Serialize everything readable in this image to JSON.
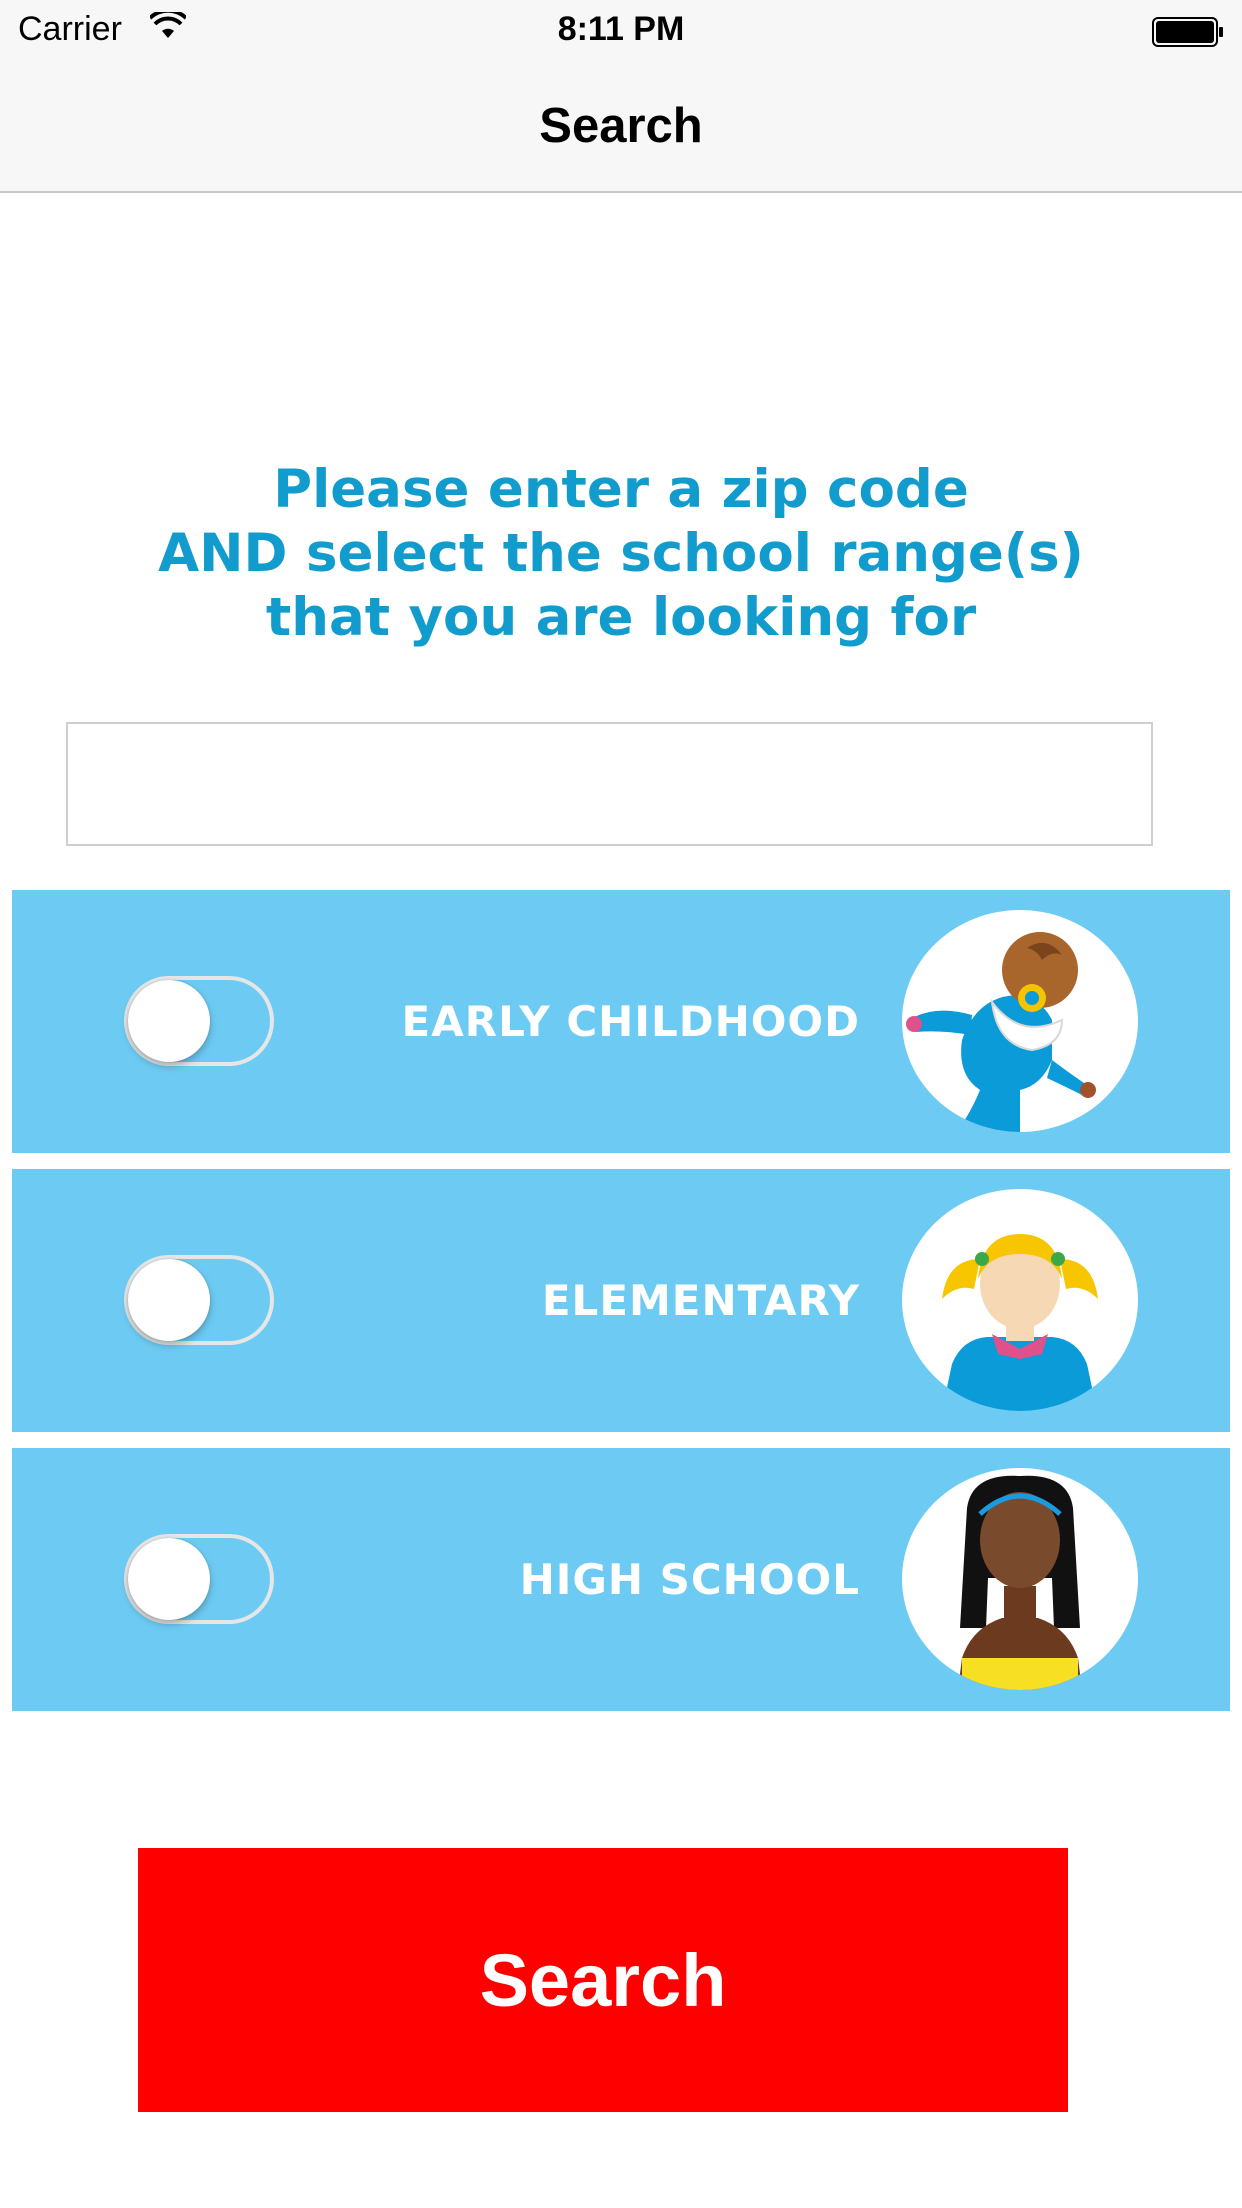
{
  "status_bar": {
    "carrier": "Carrier",
    "time": "8:11 PM"
  },
  "nav": {
    "title": "Search"
  },
  "instructions": {
    "line1": "Please enter a zip code",
    "line2": "AND select the school range(s)",
    "line3": "that you are looking for"
  },
  "zip_input": {
    "value": "",
    "placeholder": ""
  },
  "ranges": [
    {
      "label": "EARLY CHILDHOOD",
      "enabled": false,
      "icon": "baby-icon"
    },
    {
      "label": "ELEMENTARY",
      "enabled": false,
      "icon": "girl-icon"
    },
    {
      "label": "HIGH SCHOOL",
      "enabled": false,
      "icon": "teen-girl-icon"
    }
  ],
  "search_button": {
    "label": "Search"
  },
  "colors": {
    "accent_text": "#119ccd",
    "row_background": "#6dcbf3",
    "search_button": "#ff0000"
  }
}
